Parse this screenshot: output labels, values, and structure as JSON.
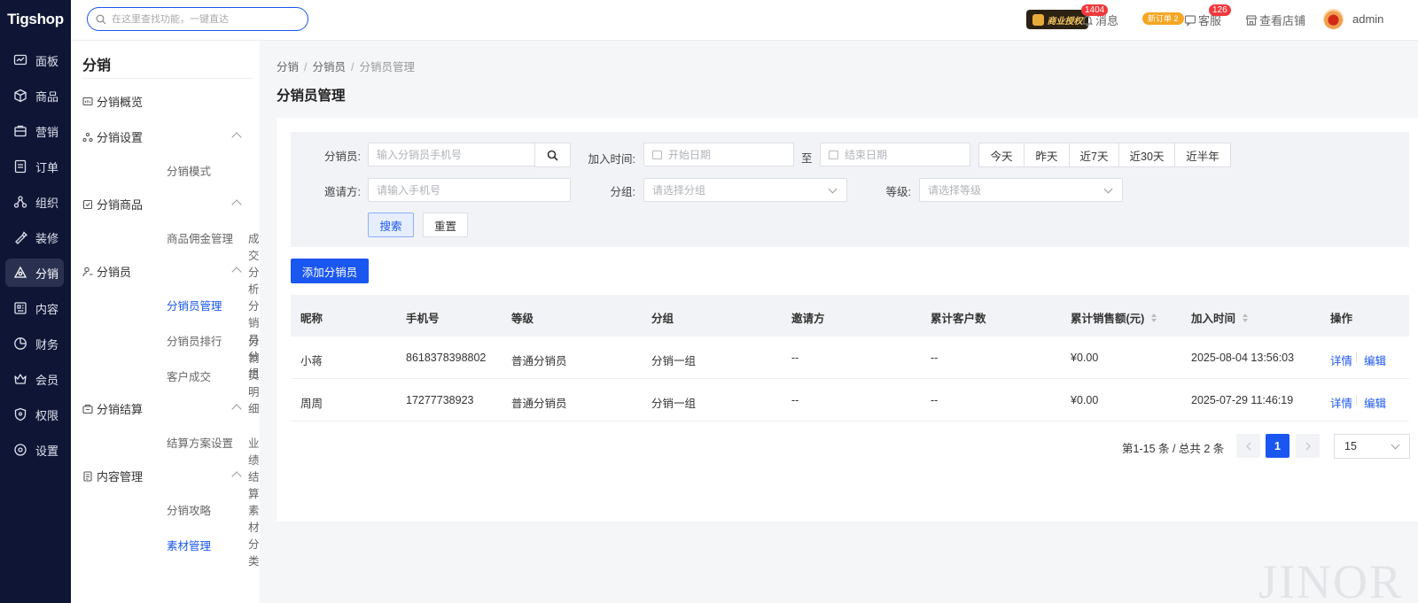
{
  "app": {
    "logo": "Tigshop"
  },
  "header": {
    "search_placeholder": "在这里查找功能，一键直达",
    "license_label": "商业授权",
    "messages": {
      "label": "消息",
      "badge": "1404"
    },
    "new_orders": "新订单 2",
    "service": {
      "label": "客服",
      "badge": "126"
    },
    "view_store": "查看店铺",
    "user": "admin"
  },
  "leftnav": {
    "items": [
      {
        "label": "面板",
        "icon": "dashboard-icon"
      },
      {
        "label": "商品",
        "icon": "box-icon"
      },
      {
        "label": "营销",
        "icon": "marketing-icon"
      },
      {
        "label": "订单",
        "icon": "order-icon"
      },
      {
        "label": "组织",
        "icon": "org-icon"
      },
      {
        "label": "装修",
        "icon": "decorate-icon"
      },
      {
        "label": "分销",
        "icon": "distribution-icon",
        "active": true
      },
      {
        "label": "内容",
        "icon": "content-icon"
      },
      {
        "label": "财务",
        "icon": "finance-icon"
      },
      {
        "label": "会员",
        "icon": "member-icon"
      },
      {
        "label": "权限",
        "icon": "permission-icon"
      },
      {
        "label": "设置",
        "icon": "settings-icon"
      }
    ]
  },
  "subnav": {
    "title": "分销",
    "overview": "分销概览",
    "groups": [
      {
        "label": "分销设置",
        "items": [
          "分销模式"
        ]
      },
      {
        "label": "分销商品",
        "items": [
          "商品佣金管理",
          "成交分析"
        ]
      },
      {
        "label": "分销员",
        "items": [
          "分销员管理",
          "分销员分组",
          "分销员排行",
          "分销员明细",
          "客户成交"
        ]
      },
      {
        "label": "分销结算",
        "items": [
          "结算方案设置",
          "业绩结算"
        ]
      },
      {
        "label": "内容管理",
        "items": [
          "分销攻略",
          "素材分类",
          "素材管理"
        ]
      }
    ]
  },
  "breadcrumb": [
    "分销",
    "分销员",
    "分销员管理"
  ],
  "page_title": "分销员管理",
  "filter": {
    "distributor_label": "分销员:",
    "distributor_placeholder": "输入分销员手机号",
    "join_time_label": "加入时间:",
    "start_placeholder": "开始日期",
    "to_label": "至",
    "end_placeholder": "结束日期",
    "quick_ranges": [
      "今天",
      "昨天",
      "近7天",
      "近30天",
      "近半年"
    ],
    "inviter_label": "邀请方:",
    "inviter_placeholder": "请输入手机号",
    "group_label": "分组:",
    "group_placeholder": "请选择分组",
    "level_label": "等级:",
    "level_placeholder": "请选择等级",
    "search_button": "搜索",
    "reset_button": "重置"
  },
  "add_button": "添加分销员",
  "table": {
    "headers": [
      "昵称",
      "手机号",
      "等级",
      "分组",
      "邀请方",
      "累计客户数",
      "累计销售额(元)",
      "加入时间",
      "操作"
    ],
    "rows": [
      {
        "nickname": "小蒋",
        "phone": "8618378398802",
        "level": "普通分销员",
        "group": "分销一组",
        "inviter": "--",
        "customers": "--",
        "sales": "¥0.00",
        "join_time": "2025-08-04 13:56:03"
      },
      {
        "nickname": "周周",
        "phone": "17277738923",
        "level": "普通分销员",
        "group": "分销一组",
        "inviter": "--",
        "customers": "--",
        "sales": "¥0.00",
        "join_time": "2025-07-29 11:46:19"
      }
    ],
    "action_detail": "详情",
    "action_edit": "编辑"
  },
  "pagination": {
    "summary": "第1-15 条 / 总共 2 条",
    "current_page": "1",
    "page_size": "15"
  },
  "watermark": "JINOR",
  "colors": {
    "primary": "#1a56f0",
    "nav_bg": "#0f1535",
    "badge_red": "#f0393c",
    "badge_orange": "#f5a623"
  }
}
